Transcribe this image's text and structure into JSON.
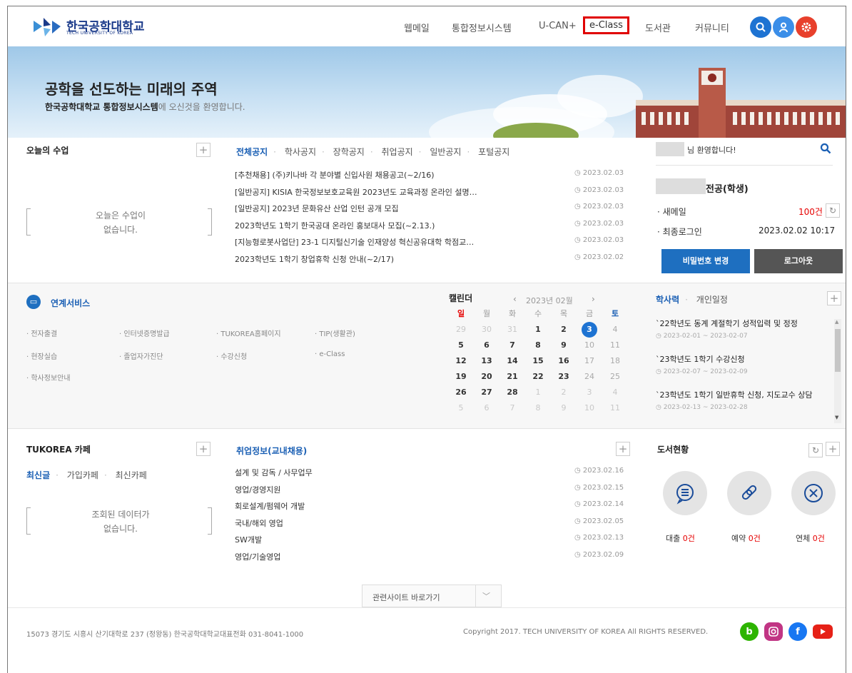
{
  "header": {
    "logo_kr": "한국공학대학교",
    "logo_en": "TECH UNIVERSITY OF KOREA",
    "nav": [
      "웹메일",
      "통합정보시스템",
      "U-CAN+",
      "e-Class",
      "도서관",
      "커뮤니티"
    ],
    "icons": [
      "search-icon",
      "user-icon",
      "gear-icon"
    ]
  },
  "banner": {
    "title": "공학을 선도하는 미래의 주역",
    "sub_bold": "한국공학대학교 통합정보시스템",
    "sub_rest": "에 오신것을 환영합니다."
  },
  "today_class": {
    "title": "오늘의 수업",
    "empty_line1": "오늘은 수업이",
    "empty_line2": "없습니다."
  },
  "notice": {
    "tabs": [
      "전체공지",
      "학사공지",
      "장학공지",
      "취업공지",
      "일반공지",
      "포털공지"
    ],
    "items": [
      {
        "title": "[추천채용] (주)키나바 각 분야별 신입사원 채용공고(~2/16)",
        "date": "2023.02.03"
      },
      {
        "title": "[일반공지] KISIA 한국정보보호교육원 2023년도 교육과정 온라인 설명…",
        "date": "2023.02.03"
      },
      {
        "title": "[일반공지] 2023년 문화유산 산업 인턴 공개 모집",
        "date": "2023.02.03"
      },
      {
        "title": "2023학년도 1학기 한국공대 온라인 홍보대사 모집(~2.13.)",
        "date": "2023.02.03"
      },
      {
        "title": "[지능형로봇사업단] 23-1 디지털신기술 인재양성 혁신공유대학 학점교…",
        "date": "2023.02.03"
      },
      {
        "title": "2023학년도 1학기 창업휴학 신청 안내(~2/17)",
        "date": "2023.02.02"
      }
    ]
  },
  "user": {
    "welcome": "님 환영합니다!",
    "major": "전공(학생)",
    "mail_label": "새메일",
    "mail_count": "100건",
    "login_label": "최종로그인",
    "login_time": "2023.02.02 10:17",
    "pw_button": "비밀번호 변경",
    "logout_button": "로그아웃"
  },
  "services": {
    "title": "연계서비스",
    "items": [
      "전자출결",
      "인터넷증명발급",
      "TUKOREA홈페이지",
      "TIP(생활관)",
      "현장실습",
      "졸업자가진단",
      "수강신청",
      "e-Class",
      "학사정보안내"
    ]
  },
  "calendar": {
    "title": "캘린더",
    "month": "2023년 02월",
    "weekdays": [
      "일",
      "월",
      "화",
      "수",
      "목",
      "금",
      "토"
    ],
    "weeks": [
      [
        "29",
        "30",
        "31",
        "1",
        "2",
        "3",
        "4"
      ],
      [
        "5",
        "6",
        "7",
        "8",
        "9",
        "10",
        "11"
      ],
      [
        "12",
        "13",
        "14",
        "15",
        "16",
        "17",
        "18"
      ],
      [
        "19",
        "20",
        "21",
        "22",
        "23",
        "24",
        "25"
      ],
      [
        "26",
        "27",
        "28",
        "1",
        "2",
        "3",
        "4"
      ],
      [
        "5",
        "6",
        "7",
        "8",
        "9",
        "10",
        "11"
      ]
    ],
    "today": "3"
  },
  "schedule": {
    "tabs": [
      "학사력",
      "개인일정"
    ],
    "items": [
      {
        "title": "`22학년도 동계 계절학기 성적입력 및 정정",
        "range": "2023-02-01 ~ 2023-02-07"
      },
      {
        "title": "`23학년도 1학기 수강신청",
        "range": "2023-02-07 ~ 2023-02-09"
      },
      {
        "title": "`23학년도 1학기 일반휴학 신청, 지도교수 상담",
        "range": "2023-02-13 ~ 2023-02-28"
      }
    ]
  },
  "cafe": {
    "title": "TUKOREA 카페",
    "tabs": [
      "최신글",
      "가입카페",
      "최신카페"
    ],
    "empty_line1": "조회된 데이터가",
    "empty_line2": "없습니다."
  },
  "jobs": {
    "title": "취업정보(교내채용)",
    "items": [
      {
        "title": "설계 및 감독 / 사무업무",
        "date": "2023.02.16"
      },
      {
        "title": "영업/경영지원",
        "date": "2023.02.15"
      },
      {
        "title": "회로설계/펌웨어 개발",
        "date": "2023.02.14"
      },
      {
        "title": "국내/해외 영업",
        "date": "2023.02.05"
      },
      {
        "title": "SW개발",
        "date": "2023.02.13"
      },
      {
        "title": "영업/기술영업",
        "date": "2023.02.09"
      }
    ]
  },
  "library": {
    "title": "도서현황",
    "items": [
      {
        "label": "대출",
        "count": "0건"
      },
      {
        "label": "예약",
        "count": "0건"
      },
      {
        "label": "연체",
        "count": "0건"
      }
    ]
  },
  "related": {
    "label": "관련사이트 바로가기"
  },
  "footer": {
    "address": "15073 경기도 시흥시 산기대학로 237 (정왕동) 한국공학대학교대표전화 031-8041-1000",
    "copyright": "Copyright 2017. TECH UNIVERSITY OF KOREA All RIGHTS RESERVED.",
    "social": [
      "blog-icon",
      "instagram-icon",
      "facebook-icon",
      "youtube-icon"
    ]
  },
  "colors": {
    "accent": "#1a5fb4",
    "brand_navy": "#1a3a8a",
    "alert_red": "#e60000",
    "button_blue": "#1e6fc0",
    "button_dark": "#555555"
  }
}
